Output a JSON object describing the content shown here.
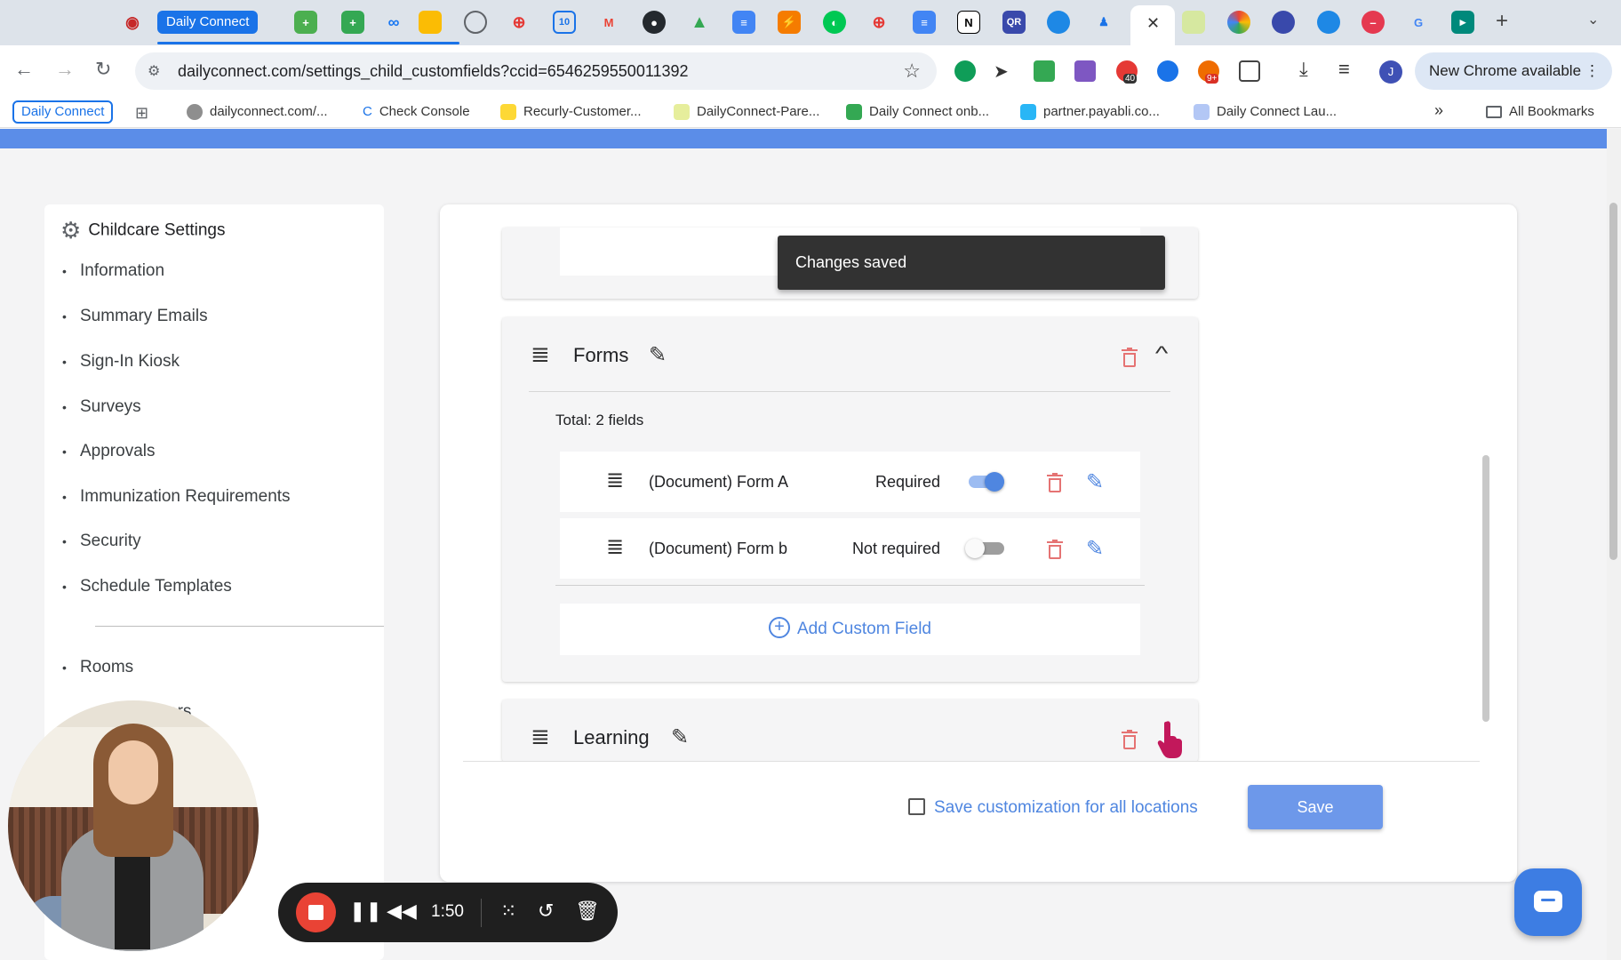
{
  "browser": {
    "tab_group_label": "Daily Connect",
    "url": "dailyconnect.com/settings_child_customfields?ccid=6546259550011392",
    "update_label": "New Chrome available",
    "profile_initial": "J",
    "ext_badge_1": "40",
    "ext_badge_2": "9+"
  },
  "bookmarks": {
    "group_label": "Daily Connect",
    "items": [
      "dailyconnect.com/...",
      "Check Console",
      "Recurly-Customer...",
      "DailyConnect-Pare...",
      "Daily Connect onb...",
      "partner.payabli.co...",
      "Daily Connect Lau..."
    ],
    "all_label": "All Bookmarks"
  },
  "sidebar": {
    "title": "Childcare Settings",
    "items": [
      "Information",
      "Summary Emails",
      "Sign-In Kiosk",
      "Surveys",
      "Approvals",
      "Immunization Requirements",
      "Security",
      "Schedule Templates"
    ],
    "items2": [
      "Rooms",
      "…ers"
    ]
  },
  "main": {
    "toast": "Changes saved",
    "forms_section": {
      "name": "Forms",
      "total": "Total: 2 fields",
      "fields": [
        {
          "name": "(Document) Form A",
          "status": "Required",
          "toggled": true
        },
        {
          "name": "(Document) Form b",
          "status": "Not required",
          "toggled": false
        }
      ],
      "add_label": "Add Custom Field"
    },
    "learning_section": {
      "name": "Learning"
    },
    "save_all_label": "Save customization for all locations",
    "save_label": "Save"
  },
  "recorder": {
    "time": "1:50"
  },
  "colors": {
    "accent": "#4f86e0",
    "brand_bar": "#5b8de8",
    "danger": "#e57373",
    "toast_bg": "#323232"
  }
}
